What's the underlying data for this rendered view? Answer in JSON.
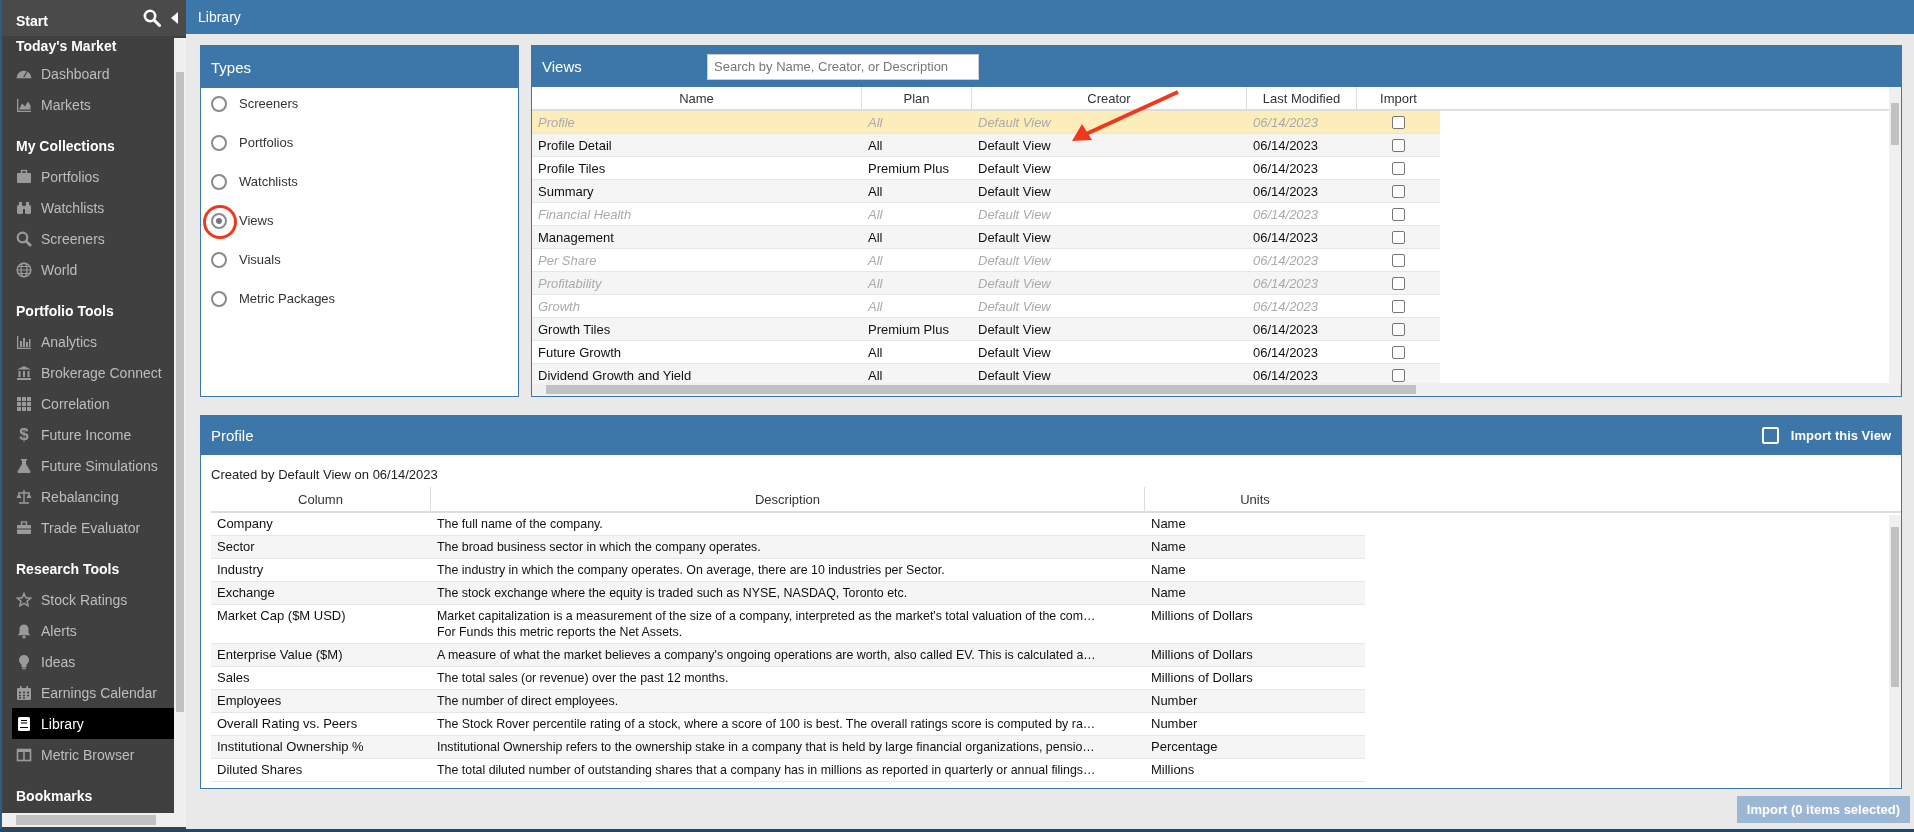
{
  "sidebar": {
    "title": "Start",
    "sections": [
      {
        "heading": "Today's Market",
        "items": [
          {
            "label": "Dashboard",
            "selected": false
          },
          {
            "label": "Markets",
            "selected": false
          }
        ]
      },
      {
        "heading": "My Collections",
        "items": [
          {
            "label": "Portfolios",
            "selected": false
          },
          {
            "label": "Watchlists",
            "selected": false
          },
          {
            "label": "Screeners",
            "selected": false
          },
          {
            "label": "World",
            "selected": false
          }
        ]
      },
      {
        "heading": "Portfolio Tools",
        "items": [
          {
            "label": "Analytics",
            "selected": false
          },
          {
            "label": "Brokerage Connect",
            "selected": false
          },
          {
            "label": "Correlation",
            "selected": false
          },
          {
            "label": "Future Income",
            "selected": false,
            "glyph": "$"
          },
          {
            "label": "Future Simulations",
            "selected": false
          },
          {
            "label": "Rebalancing",
            "selected": false
          },
          {
            "label": "Trade Evaluator",
            "selected": false
          }
        ]
      },
      {
        "heading": "Research Tools",
        "items": [
          {
            "label": "Stock Ratings",
            "selected": false
          },
          {
            "label": "Alerts",
            "selected": false
          },
          {
            "label": "Ideas",
            "selected": false
          },
          {
            "label": "Earnings Calendar",
            "selected": false
          },
          {
            "label": "Library",
            "selected": true
          },
          {
            "label": "Metric Browser",
            "selected": false
          }
        ]
      },
      {
        "heading": "Bookmarks"
      }
    ]
  },
  "page_title": "Library",
  "types": {
    "title": "Types",
    "options": [
      {
        "label": "Screeners",
        "selected": false
      },
      {
        "label": "Portfolios",
        "selected": false
      },
      {
        "label": "Watchlists",
        "selected": false
      },
      {
        "label": "Views",
        "selected": true
      },
      {
        "label": "Visuals",
        "selected": false
      },
      {
        "label": "Metric Packages",
        "selected": false
      }
    ]
  },
  "views": {
    "title": "Views",
    "search": {
      "placeholder": "Search by Name, Creator, or Description"
    },
    "columns": [
      "Name",
      "Plan",
      "Creator",
      "Last Modified",
      "Import"
    ],
    "rows": [
      {
        "name": "Profile",
        "plan": "All",
        "creator": "Default View",
        "modified": "06/14/2023",
        "dimmed": true,
        "selected": true,
        "checked": false
      },
      {
        "name": "Profile Detail",
        "plan": "All",
        "creator": "Default View",
        "modified": "06/14/2023",
        "dimmed": false,
        "selected": false,
        "checked": false
      },
      {
        "name": "Profile Tiles",
        "plan": "Premium Plus",
        "creator": "Default View",
        "modified": "06/14/2023",
        "dimmed": false,
        "selected": false,
        "checked": false
      },
      {
        "name": "Summary",
        "plan": "All",
        "creator": "Default View",
        "modified": "06/14/2023",
        "dimmed": false,
        "selected": false,
        "checked": false
      },
      {
        "name": "Financial Health",
        "plan": "All",
        "creator": "Default View",
        "modified": "06/14/2023",
        "dimmed": true,
        "selected": false,
        "checked": false
      },
      {
        "name": "Management",
        "plan": "All",
        "creator": "Default View",
        "modified": "06/14/2023",
        "dimmed": false,
        "selected": false,
        "checked": false
      },
      {
        "name": "Per Share",
        "plan": "All",
        "creator": "Default View",
        "modified": "06/14/2023",
        "dimmed": true,
        "selected": false,
        "checked": false
      },
      {
        "name": "Profitability",
        "plan": "All",
        "creator": "Default View",
        "modified": "06/14/2023",
        "dimmed": true,
        "selected": false,
        "checked": false
      },
      {
        "name": "Growth",
        "plan": "All",
        "creator": "Default View",
        "modified": "06/14/2023",
        "dimmed": true,
        "selected": false,
        "checked": false
      },
      {
        "name": "Growth Tiles",
        "plan": "Premium Plus",
        "creator": "Default View",
        "modified": "06/14/2023",
        "dimmed": false,
        "selected": false,
        "checked": false
      },
      {
        "name": "Future Growth",
        "plan": "All",
        "creator": "Default View",
        "modified": "06/14/2023",
        "dimmed": false,
        "selected": false,
        "checked": false
      },
      {
        "name": "Dividend Growth and Yield",
        "plan": "All",
        "creator": "Default View",
        "modified": "06/14/2023",
        "dimmed": false,
        "selected": false,
        "checked": false
      }
    ]
  },
  "profile": {
    "title": "Profile",
    "import_toggle": {
      "label": "Import this View",
      "checked": false
    },
    "created": "Created by Default View on 06/14/2023",
    "columns": [
      "Column",
      "Description",
      "Units"
    ],
    "rows": [
      {
        "column": "Company",
        "description": "The full name of the company.",
        "units": "Name"
      },
      {
        "column": "Sector",
        "description": "The broad business sector in which the company operates.",
        "units": "Name"
      },
      {
        "column": "Industry",
        "description": "The industry in which the company operates. On average, there are 10 industries per Sector.",
        "units": "Name"
      },
      {
        "column": "Exchange",
        "description": "The stock exchange where the equity is traded such as NYSE, NASDAQ, Toronto etc.",
        "units": "Name"
      },
      {
        "column": "Market Cap ($M USD)",
        "description": "Market capitalization is a measurement of the size of a company, interpreted as the market's total valuation of the com…",
        "description_2": "For Funds this metric reports the Net Assets.",
        "units": "Millions of Dollars"
      },
      {
        "column": "Enterprise Value ($M)",
        "description": "A measure of what the market believes a company's ongoing operations are worth, also called EV. This is calculated a…",
        "units": "Millions of Dollars"
      },
      {
        "column": "Sales",
        "description": "The total sales (or revenue) over the past 12 months.",
        "units": "Millions of Dollars"
      },
      {
        "column": "Employees",
        "description": "The number of direct employees.",
        "units": "Number"
      },
      {
        "column": "Overall Rating vs. Peers",
        "description": "The Stock Rover percentile rating of a stock, where a score of 100 is best. The overall ratings score is computed by ra…",
        "units": "Number"
      },
      {
        "column": "Institutional Ownership %",
        "description": "Institutional Ownership refers to the ownership stake in a company that is held by large financial organizations, pensio…",
        "units": "Percentage"
      },
      {
        "column": "Diluted Shares",
        "description": "The total diluted number of outstanding shares that a company has in millions as reported in quarterly or annual filings…",
        "units": "Millions"
      }
    ]
  },
  "import_button": {
    "label": "Import (0 items selected)",
    "disabled": true
  }
}
